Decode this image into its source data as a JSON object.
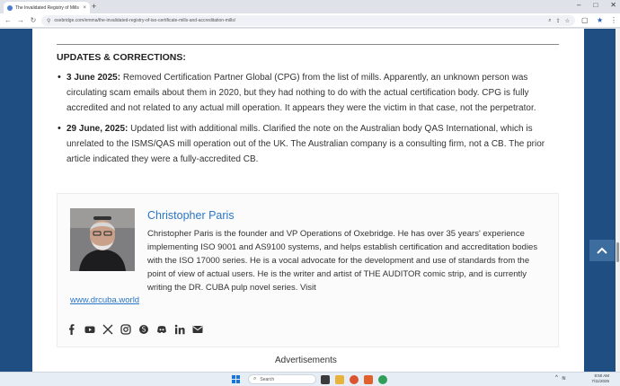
{
  "browser": {
    "tab_title": "The Invalidated Registry of Mills",
    "tab_close": "×",
    "new_tab": "+",
    "url": "oxebridge.com/emma/the-invalidated-registry-of-iso-certificate-mills-and-accreditation-mills/",
    "window_controls": [
      "–",
      "□",
      "✕"
    ]
  },
  "article": {
    "section_heading": "UPDATES & CORRECTIONS:",
    "updates": [
      {
        "date": "3 June 2025:",
        "text": " Removed Certification Partner Global (CPG) from the list of mills. Apparently, an unknown person was circulating scam emails about them in 2020, but they had nothing to do with the actual certification body. CPG is fully accredited and not related to any actual mill operation. It appears they were the victim in that case, not the perpetrator."
      },
      {
        "date": "29 June, 2025:",
        "text": " Updated list with additional mills. Clarified the note on the Australian body QAS International, which is unrelated to the ISMS/QAS mill operation out of the UK. The Australian company is a consulting firm, not a CB. The prior article indicated they were a fully-accredited CB."
      }
    ]
  },
  "author": {
    "name": "Christopher Paris",
    "bio": "Christopher Paris is the founder and VP Operations of Oxebridge. He has over 35 years' experience implementing ISO 9001 and AS9100 systems, and helps establish certification and accreditation bodies with the ISO 17000 series. He is a vocal advocate for the development and use of standards from the point of view of actual users. He is the writer and artist of THE AUDITOR comic strip, and is currently writing the DR. CUBA pulp novel series.  Visit",
    "link": "www.drcuba.world",
    "socials": [
      "facebook-icon",
      "youtube-icon",
      "x-icon",
      "instagram-icon",
      "skype-icon",
      "discord-icon",
      "linkedin-icon",
      "envelope-icon"
    ]
  },
  "ads_label": "Advertisements",
  "taskbar": {
    "search_placeholder": "Search",
    "time": "8:50 AM",
    "date": "7/11/2025"
  },
  "colors": {
    "page_bg": "#1f4f82",
    "link": "#2a76c6",
    "scroll_top_button": "#3d6d9e"
  }
}
